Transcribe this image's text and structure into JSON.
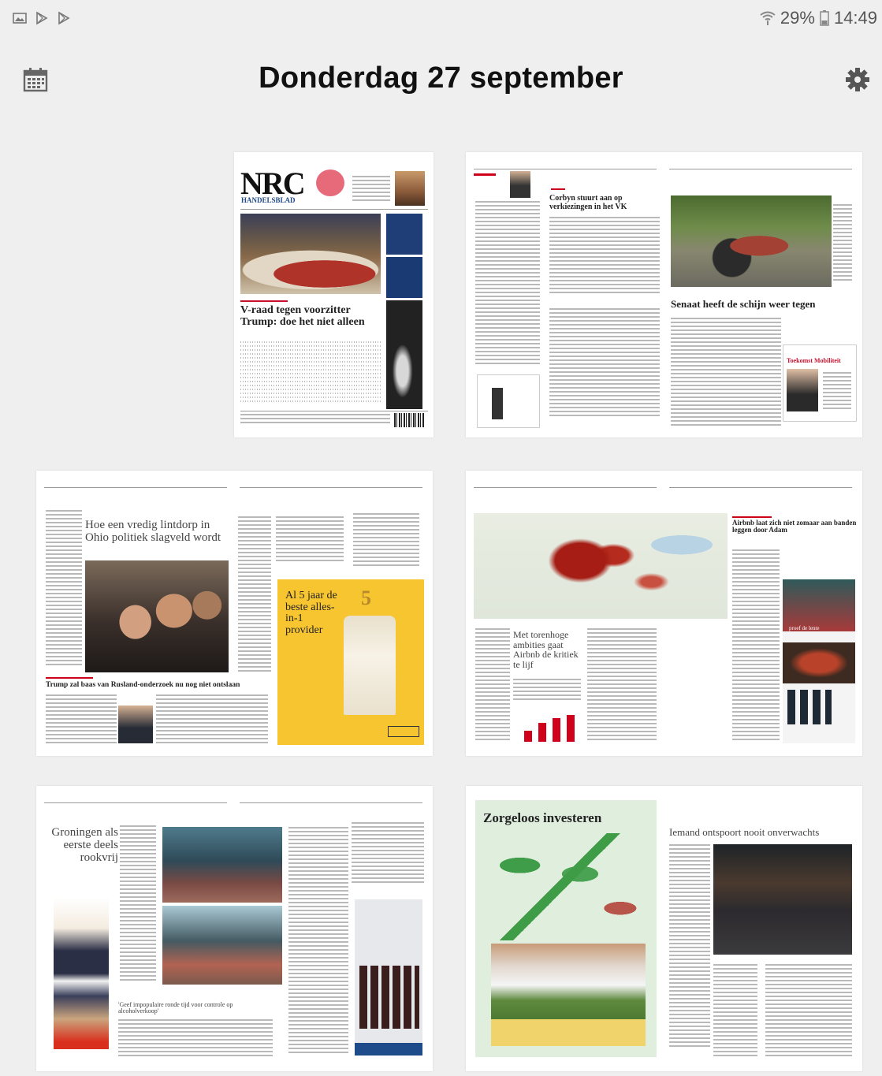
{
  "status": {
    "battery": "29%",
    "time": "14:49",
    "icons": [
      "gallery-icon",
      "play-store-icon",
      "play-store-icon",
      "wifi-icon",
      "battery-icon"
    ]
  },
  "header": {
    "title": "Donderdag 27 september",
    "calendar_icon": "calendar-icon",
    "settings_icon": "gear-icon"
  },
  "pages": {
    "front": {
      "masthead": "NRC",
      "masthead_sub": "HANDELSBLAD",
      "headline": "V-raad tegen voorzitter Trump: doe het niet alleen"
    },
    "spread1": {
      "left_headline": "Corbyn stuurt aan op verkiezingen in het VK",
      "right_headline": "Senaat heeft de schijn weer tegen",
      "ad_name": "Toekomst Mobiliteit"
    },
    "spread2": {
      "left_headline": "Hoe een vredig lintdorp in Ohio politiek slagveld wordt",
      "bottom_headline": "Trump zal baas van Rusland-onderzoek nu nog niet ontslaan",
      "ad_text": "Al 5 jaar de beste alles-in-1 provider",
      "ad_number": "5"
    },
    "spread3": {
      "left_headline": "Met torenhoge ambities gaat Airbnb de kritiek te lijf",
      "right_headline": "Airbnb laat zich niet zomaar aan banden leggen door Adam",
      "ad_text": "proef de lente"
    },
    "spread4": {
      "left_headline": "Groningen als eerste deels rookvrij",
      "bottom_headline": "'Geef impopulaire ronde tijd voor controle op alcoholverkoop'"
    },
    "spread5": {
      "left_headline": "Zorgeloos investeren",
      "right_headline": "Iemand ontspoort nooit onverwachts"
    }
  },
  "colors": {
    "background": "#efefef",
    "title": "#111111",
    "accent_red": "#d0021b",
    "ad_yellow": "#f7c530",
    "green_ad": "#dfeedd"
  }
}
